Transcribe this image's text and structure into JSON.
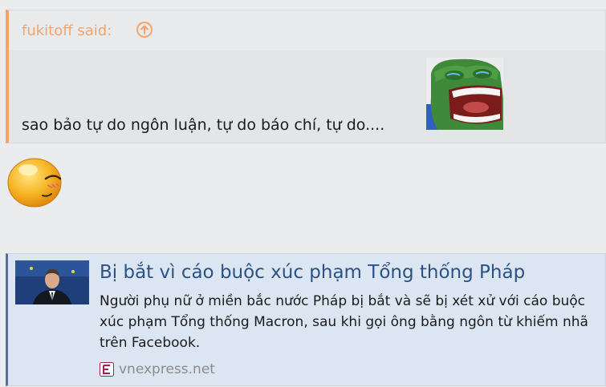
{
  "quote": {
    "author_label": "fukitoff said:",
    "text": "sao bảo tự do ngôn luận, tự do báo chí, tự do....",
    "accent_color": "#f2a46c",
    "jump_icon": "arrow-up-circle-icon",
    "image": "laughing-pepe-frog-image"
  },
  "reaction": {
    "icon": "blushing-smiley-icon"
  },
  "link_preview": {
    "title": "Bị bắt vì cáo buộc xúc phạm Tổng thống Pháp",
    "description": "Người phụ nữ ở miền bắc nước Pháp bị bắt và sẽ bị xét xử với cáo buộc xúc phạm Tổng thống Macron, sau khi gọi ông bằng ngôn từ khiếm nhã trên Facebook.",
    "source": "vnexpress.net",
    "source_icon": "vnexpress-logo-icon",
    "accent_color": "#5a6f97",
    "title_color": "#2c5285"
  }
}
